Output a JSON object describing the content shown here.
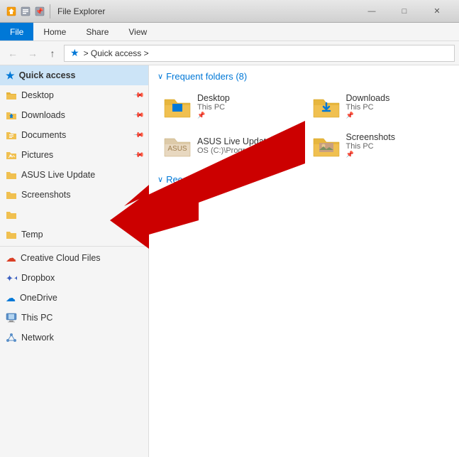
{
  "titleBar": {
    "title": "File Explorer",
    "icons": [
      "home-icon",
      "document-icon",
      "pin-icon"
    ],
    "controls": [
      "minimize",
      "maximize",
      "close"
    ]
  },
  "menuBar": {
    "tabs": [
      "File",
      "Home",
      "Share",
      "View"
    ],
    "activeTab": "File"
  },
  "toolbar": {
    "backBtn": "←",
    "forwardBtn": "→",
    "upBtn": "↑",
    "addressParts": [
      "Quick access",
      ">"
    ],
    "addressLabel": "> Quick access >"
  },
  "sidebar": {
    "items": [
      {
        "id": "quick-access",
        "label": "Quick access",
        "icon": "star",
        "type": "header"
      },
      {
        "id": "desktop",
        "label": "Desktop",
        "icon": "folder",
        "pinned": true
      },
      {
        "id": "downloads",
        "label": "Downloads",
        "icon": "folder-download",
        "pinned": true
      },
      {
        "id": "documents",
        "label": "Documents",
        "icon": "folder-document",
        "pinned": true
      },
      {
        "id": "pictures",
        "label": "Pictures",
        "icon": "folder-picture",
        "pinned": true
      },
      {
        "id": "asus-live-update",
        "label": "ASUS Live Update",
        "icon": "folder"
      },
      {
        "id": "screenshots",
        "label": "Screenshots",
        "icon": "folder"
      },
      {
        "id": "unnamed",
        "label": "",
        "icon": "folder"
      },
      {
        "id": "temp",
        "label": "Temp",
        "icon": "folder"
      },
      {
        "id": "creative-cloud",
        "label": "Creative Cloud Files",
        "icon": "cc"
      },
      {
        "id": "dropbox",
        "label": "Dropbox",
        "icon": "dropbox"
      },
      {
        "id": "onedrive",
        "label": "OneDrive",
        "icon": "onedrive"
      },
      {
        "id": "this-pc",
        "label": "This PC",
        "icon": "thispc"
      },
      {
        "id": "network",
        "label": "Network",
        "icon": "network"
      }
    ]
  },
  "content": {
    "frequentFolders": {
      "header": "Frequent folders (8)",
      "items": [
        {
          "id": "desktop-f",
          "name": "Desktop",
          "sub": "This PC",
          "pinned": true,
          "type": "folder"
        },
        {
          "id": "downloads-f",
          "name": "Downloads",
          "sub": "This PC",
          "type": "folder-download"
        },
        {
          "id": "asus-update-f",
          "name": "ASUS Live Update",
          "sub": "OS (C:)\\ProgramData\\ASUS",
          "type": "folder-light"
        },
        {
          "id": "screenshots-f",
          "name": "Screenshots",
          "sub": "This PC",
          "type": "folder-photo"
        }
      ]
    },
    "recentFiles": {
      "header": "Recent files (20)"
    }
  },
  "arrow": {
    "visible": true,
    "color": "#cc0000"
  }
}
